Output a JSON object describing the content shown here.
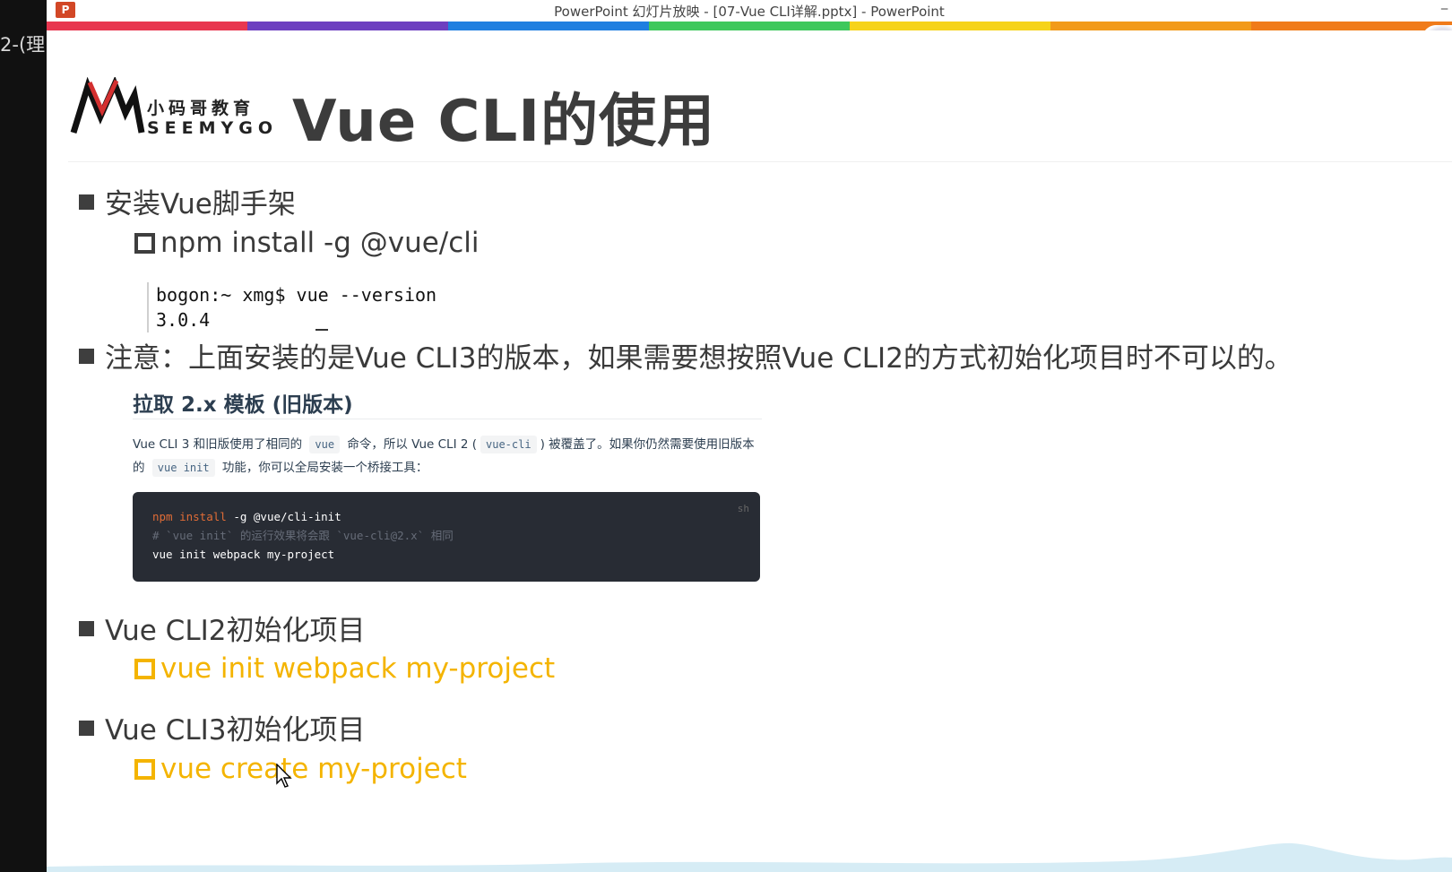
{
  "window": {
    "title": "PowerPoint 幻灯片放映 - [07-Vue CLI详解.pptx] - PowerPoint",
    "app_icon_label": "P",
    "background_text": "2-(理"
  },
  "color_band": [
    "#e8364f",
    "#6d3fc0",
    "#1f7fe0",
    "#3ec85c",
    "#f6d31a",
    "#f29a1a",
    "#f07b1a"
  ],
  "logo": {
    "cn": "小码哥教育",
    "en": "SEEMYGO"
  },
  "slide": {
    "title": "Vue CLI的使用",
    "sections": [
      {
        "bullet": "安装Vue脚手架",
        "sub": "npm install -g @vue/cli"
      },
      {
        "bullet": "注意：上面安装的是Vue CLI3的版本，如果需要想按照Vue CLI2的方式初始化项目时不可以的。"
      },
      {
        "bullet": "Vue CLI2初始化项目",
        "sub": "vue init webpack my-project"
      },
      {
        "bullet": "Vue CLI3初始化项目",
        "sub": "vue create my-project"
      }
    ],
    "terminal": {
      "line1": "bogon:~ xmg$ vue --version",
      "line2": "3.0.4"
    },
    "doc": {
      "heading": "拉取 2.x 模板 (旧版本)",
      "para_part1": "Vue CLI 3 和旧版使用了相同的",
      "code1": "vue",
      "para_part2": "命令，所以 Vue CLI 2 (",
      "code2": "vue-cli",
      "para_part3": ") 被覆盖了。如果你仍然需要使用旧版本的",
      "code3": "vue init",
      "para_part4": "功能，你可以全局安装一个桥接工具：",
      "code_lang": "sh",
      "code_line1_kw": "npm install",
      "code_line1_rest": " -g @vue/cli-init",
      "code_line2": "# `vue init` 的运行效果将会跟 `vue-cli@2.x` 相同",
      "code_line3": "vue init webpack my-project"
    }
  },
  "colors": {
    "accent_yellow": "#f4b400",
    "code_bg": "#282c34"
  }
}
